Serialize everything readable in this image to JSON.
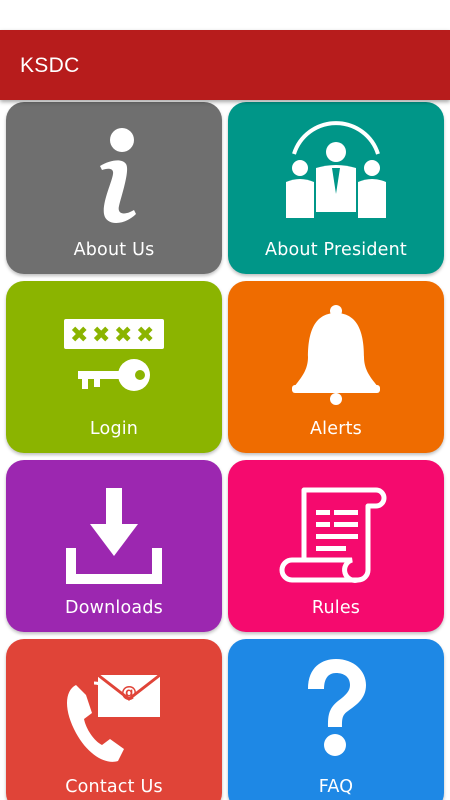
{
  "app": {
    "title": "KSDC",
    "toolbar_color": "#b71c1c"
  },
  "tiles": [
    {
      "label": "About Us",
      "icon": "info-icon",
      "color": "#6f6f6f"
    },
    {
      "label": "About President",
      "icon": "people-icon",
      "color": "#009688"
    },
    {
      "label": "Login",
      "icon": "password-key-icon",
      "color": "#8bb400"
    },
    {
      "label": "Alerts",
      "icon": "bell-icon",
      "color": "#ef6c00"
    },
    {
      "label": "Downloads",
      "icon": "download-icon",
      "color": "#9c27b0"
    },
    {
      "label": "Rules",
      "icon": "scroll-icon",
      "color": "#f50a6e"
    },
    {
      "label": "Contact Us",
      "icon": "phone-mail-icon",
      "color": "#e04438"
    },
    {
      "label": "FAQ",
      "icon": "question-icon",
      "color": "#1e88e5"
    }
  ]
}
